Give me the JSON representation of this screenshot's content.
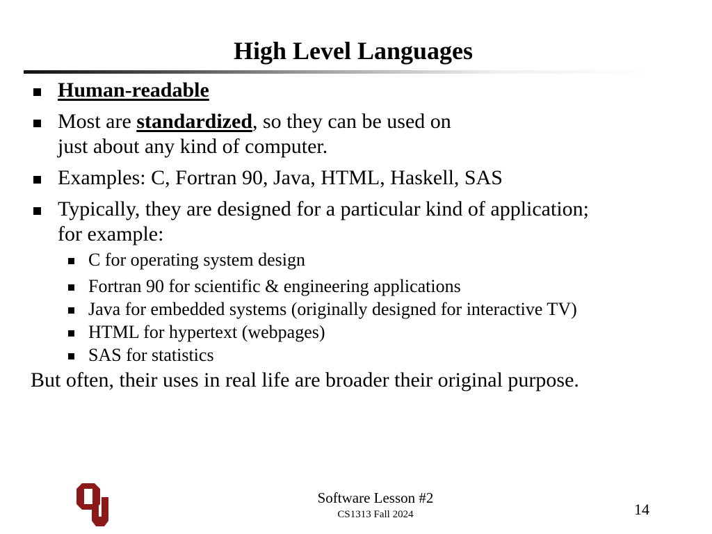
{
  "slide": {
    "title": "High Level Languages",
    "bullets": {
      "b1": {
        "text": "Human-readable"
      },
      "b2": {
        "pre": "Most are ",
        "bold": "standardized",
        "post": ", so they can be used on",
        "line2": "just about any kind of computer."
      },
      "b3": {
        "text": "Examples: C, Fortran 90, Java, HTML, Haskell, SAS"
      },
      "b4": {
        "line1": "Typically, they are designed for a particular kind of application;",
        "line2": "for example:"
      }
    },
    "sub_bullets": [
      "C for operating system design",
      "Fortran 90 for scientific & engineering applications",
      "Java for embedded systems (originally designed for interactive TV)",
      "HTML for hypertext (webpages)",
      "SAS for statistics"
    ],
    "closing": "But often, their uses in real life are broader their original purpose."
  },
  "footer": {
    "lesson": "Software Lesson #2",
    "course": "CS1313 Fall 2024",
    "page_number": "14",
    "logo": "ou-logo-icon",
    "logo_color": "#8b1a1a"
  }
}
